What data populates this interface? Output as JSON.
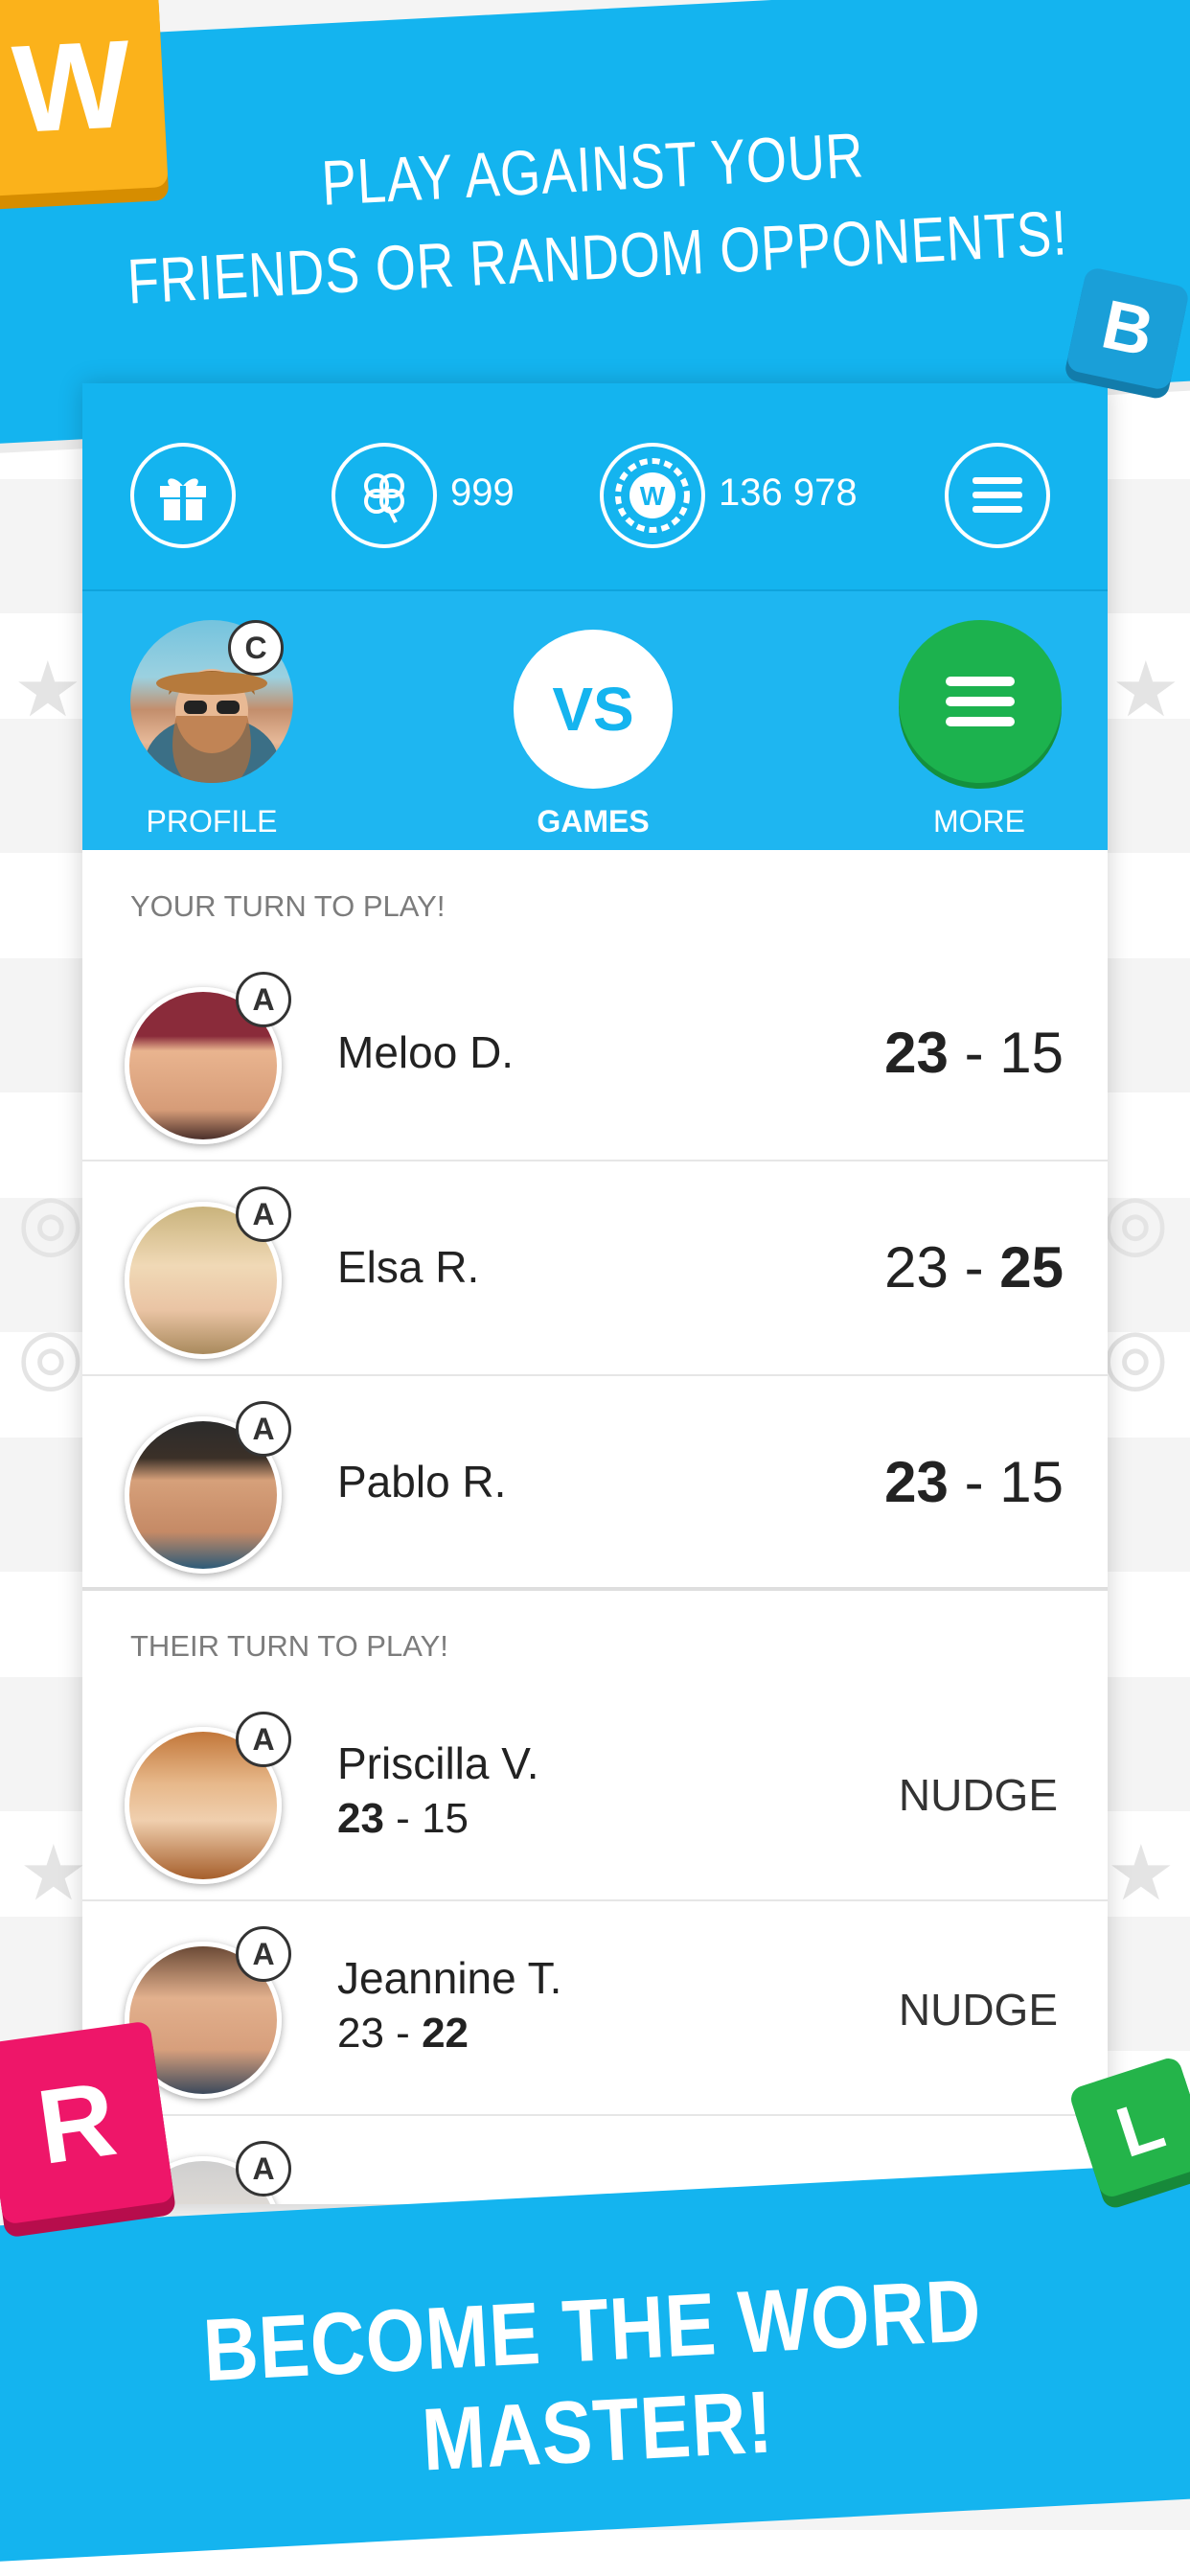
{
  "promo": {
    "top_line1": "PLAY AGAINST YOUR",
    "top_line2": "FRIENDS OR RANDOM OPPONENTS!",
    "bottom": "BECOME THE WORD MASTER!",
    "tiles": [
      "W",
      "B",
      "R",
      "L"
    ]
  },
  "stats": {
    "clovers": "999",
    "coins": "136 978",
    "coin_letter": "W"
  },
  "nav": {
    "profile_label": "PROFILE",
    "profile_badge": "C",
    "vs_label": "VS",
    "games_label": "GAMES",
    "more_label": "MORE"
  },
  "your_turn": {
    "title": "YOUR TURN TO PLAY!",
    "rows": [
      {
        "name": "Meloo D.",
        "badge": "A",
        "score_left": "23",
        "dash": " - ",
        "score_right": "15"
      },
      {
        "name": "Elsa R.",
        "badge": "A",
        "score_left": "23",
        "dash": " - ",
        "score_right": "25"
      },
      {
        "name": "Pablo R.",
        "badge": "A",
        "score_left": "23",
        "dash": " - ",
        "score_right": "15"
      }
    ]
  },
  "their_turn": {
    "title": "THEIR TURN TO PLAY!",
    "rows": [
      {
        "name": "Priscilla V.",
        "badge": "A",
        "score_left": "23",
        "dash": " - ",
        "score_right": "15",
        "action": "NUDGE"
      },
      {
        "name": "Jeannine T.",
        "badge": "A",
        "score_left": "23",
        "dash": " - ",
        "score_right": "22",
        "action": "NUDGE"
      },
      {
        "badge": "A"
      }
    ]
  },
  "colors": {
    "brand_blue": "#14b4ef",
    "more_green": "#1cb24e",
    "tile_yellow": "#fbb21b",
    "tile_pink": "#ee1669",
    "tile_green": "#24b44a"
  }
}
